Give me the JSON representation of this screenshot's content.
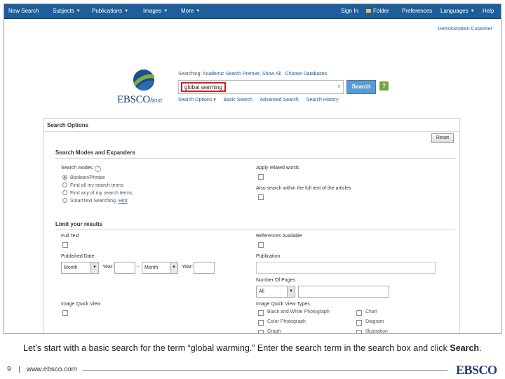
{
  "nav": {
    "items": [
      {
        "label": "New Search",
        "caret": false
      },
      {
        "label": "Subjects",
        "caret": true
      },
      {
        "label": "Publications",
        "caret": true
      },
      {
        "label": "Images",
        "caret": true
      },
      {
        "label": "More",
        "caret": true
      }
    ],
    "right": [
      {
        "label": "Sign In",
        "caret": false
      },
      {
        "label": "Folder",
        "caret": false
      },
      {
        "label": "Preferences",
        "caret": false
      },
      {
        "label": "Languages",
        "caret": true
      },
      {
        "label": "Help",
        "caret": false
      }
    ]
  },
  "account": {
    "customer": "Demonstration Customer"
  },
  "logo": {
    "ebsco": "EBSCO",
    "host": "host"
  },
  "search": {
    "searching_prefix": "Searching:",
    "database": "Academic Search Premier, Show All",
    "choose_databases": "Choose Databases",
    "query": "global warming",
    "clear": "×",
    "button": "Search",
    "help": "?",
    "links": [
      "Search Options ▾",
      "Basic Search",
      "Advanced Search",
      "Search History"
    ]
  },
  "options": {
    "title": "Search Options",
    "reset": "Reset",
    "modes": {
      "section": "Search Modes and Expanders",
      "label": "Search modes",
      "help": "?",
      "items": [
        "Boolean/Phrase",
        "Find all my search terms",
        "Find any of my search terms",
        "SmartText Searching"
      ],
      "hint": "Hint",
      "apply_related": "Apply related words",
      "also_search": "Also search within the full text of the articles"
    },
    "limit": {
      "section": "Limit your results",
      "full_text": "Full Text",
      "references": "References Available",
      "published_date": "Published Date",
      "month1": "Month",
      "year1": "Year:",
      "dash": "-",
      "month2": "Month",
      "year2": "Year:",
      "publication": "Publication",
      "pages": "Number Of Pages",
      "pages_value": "All",
      "image_quick_view": "Image Quick View",
      "iqv_types": "Image Quick View Types",
      "types_left": [
        "Black and White Photograph",
        "Color Photograph",
        "Graph"
      ],
      "types_right": [
        "Chart",
        "Diagram",
        "Illustration"
      ]
    }
  },
  "caption": {
    "text": "Let’s start with a basic search for the term “global warming.” Enter the search term in the search box and click ",
    "bold": "Search",
    "end": "."
  },
  "footer": {
    "page": "9",
    "separator": "|",
    "url": "www.ebsco.com",
    "logo": "EBSCO"
  }
}
